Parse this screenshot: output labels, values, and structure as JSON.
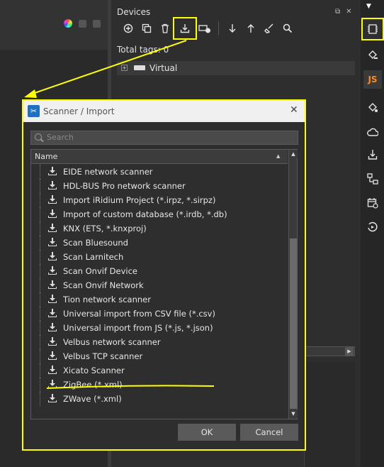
{
  "devices_panel": {
    "title": "Devices",
    "total_tags": "Total tags: 0",
    "tree": [
      {
        "label": "Virtual",
        "expander": "+"
      }
    ],
    "toolbar_icons": [
      "add-icon",
      "duplicate-icon",
      "delete-icon",
      "import-icon",
      "add-device-icon",
      "move-down-icon",
      "move-up-icon",
      "clean-icon",
      "search-icon"
    ]
  },
  "right_sidebar": {
    "icons": [
      "devices-icon",
      "paint-bucket-icon",
      "js-icon",
      "paint-settings-icon",
      "cloud-icon",
      "import-icon",
      "flow-icon",
      "schedule-icon",
      "history-icon"
    ],
    "js_label": "JS"
  },
  "dialog": {
    "title": "Scanner / Import",
    "close_glyph": "✕",
    "search_placeholder": "Search",
    "column_header": "Name",
    "items": [
      "EIDE network scanner",
      "HDL-BUS Pro network scanner",
      "Import iRidium Project (*.irpz, *.sirpz)",
      "Import of custom database (*.irdb, *.db)",
      "KNX (ETS, *.knxproj)",
      "Scan Bluesound",
      "Scan Larnitech",
      "Scan Onvif Device",
      "Scan Onvif Network",
      "Tion network scanner",
      "Universal import from CSV file (*.csv)",
      "Universal import from JS (*.js, *.json)",
      "Velbus network scanner",
      "Velbus TCP scanner",
      "Xicato Scanner",
      "ZigBee (*.xml)",
      "ZWave (*.xml)"
    ],
    "ok_label": "OK",
    "cancel_label": "Cancel"
  },
  "annotations": {
    "highlight_color": "#ffff00"
  }
}
